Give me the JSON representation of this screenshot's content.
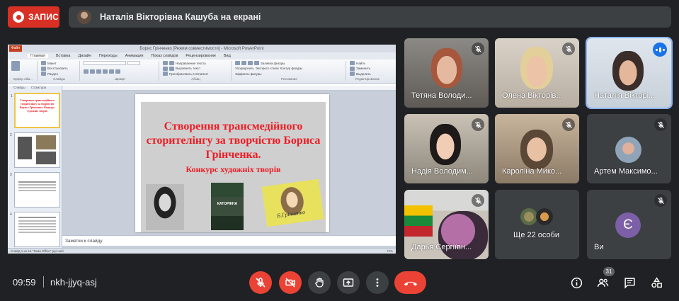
{
  "top": {
    "record_label": "ЗАПИС",
    "presenting_text": "Наталія Вікторівна Кашуба на екрані"
  },
  "ppt": {
    "window_title": "Борис Грінченко [Режим совместимости] - Microsoft PowerPoint",
    "file_tab": "Файл",
    "tabs": [
      "Главная",
      "Вставка",
      "Дизайн",
      "Переходы",
      "Анимация",
      "Показ слайдов",
      "Рецензирование",
      "Вид"
    ],
    "ribbon_groups": [
      "Буфер обм...",
      "Слайды",
      "Шрифт",
      "Абзац",
      "Рисование",
      "Редактирование"
    ],
    "ribbon_items": [
      "Создать слайд",
      "Макет",
      "Восстановить",
      "Раздел",
      "Направление текста",
      "Выровнять текст",
      "Преобразовать в SmartArt",
      "Упорядочить",
      "Экспресс-стили",
      "Заливка фигуры",
      "Контур фигуры",
      "Эффекты фигуры",
      "Найти",
      "Заменить",
      "Выделить"
    ],
    "panel_tabs": [
      "Слайды",
      "Структура"
    ],
    "thumb_numbers": [
      "1",
      "2",
      "3",
      "4"
    ],
    "thumb1_text": "Створення трансмедійного сторителінгу за творчістю Бориса Грінченка. Конкурс художніх творів",
    "slide": {
      "title": "Створення трансмедійного сторителінгу за творчістю Бориса Грінченка.",
      "subtitle": "Конкурс художніх творів",
      "book_text": "КАТОРЖНА",
      "signature": "Б.Грінченко"
    },
    "notes": "Заметки к слайду",
    "status_left": "Слайд 1 из 16    \"Тема Office\"    русский",
    "status_right": "72%"
  },
  "participants": [
    {
      "name": "Тетяна Володи...",
      "state": "muted"
    },
    {
      "name": "Олена Вікторів...",
      "state": "muted"
    },
    {
      "name": "Наталія Вікторі...",
      "state": "speaking"
    },
    {
      "name": "Надія Володим...",
      "state": "muted"
    },
    {
      "name": "Кароліна Мико...",
      "state": "muted"
    },
    {
      "name": "Артем Максимо...",
      "state": "muted"
    },
    {
      "name": "Дарья Сергіївн...",
      "state": "muted"
    },
    {
      "name": "Ще 22 особи",
      "state": ""
    },
    {
      "name": "Ви",
      "state": "muted",
      "initial": "Є"
    }
  ],
  "bottom": {
    "time": "09:59",
    "meeting_code": "nkh-jjyq-asj",
    "people_count": "31"
  },
  "colors": {
    "background": "#202124",
    "record_red": "#d93025",
    "control_red": "#ea4335",
    "speaking_blue": "#1a73e8",
    "slide_red": "#ed1c24"
  },
  "icons": [
    "mic-off-icon",
    "camera-off-icon",
    "hand-icon",
    "present-icon",
    "more-icon",
    "call-end-icon",
    "info-icon",
    "people-icon",
    "chat-icon",
    "activities-icon"
  ]
}
